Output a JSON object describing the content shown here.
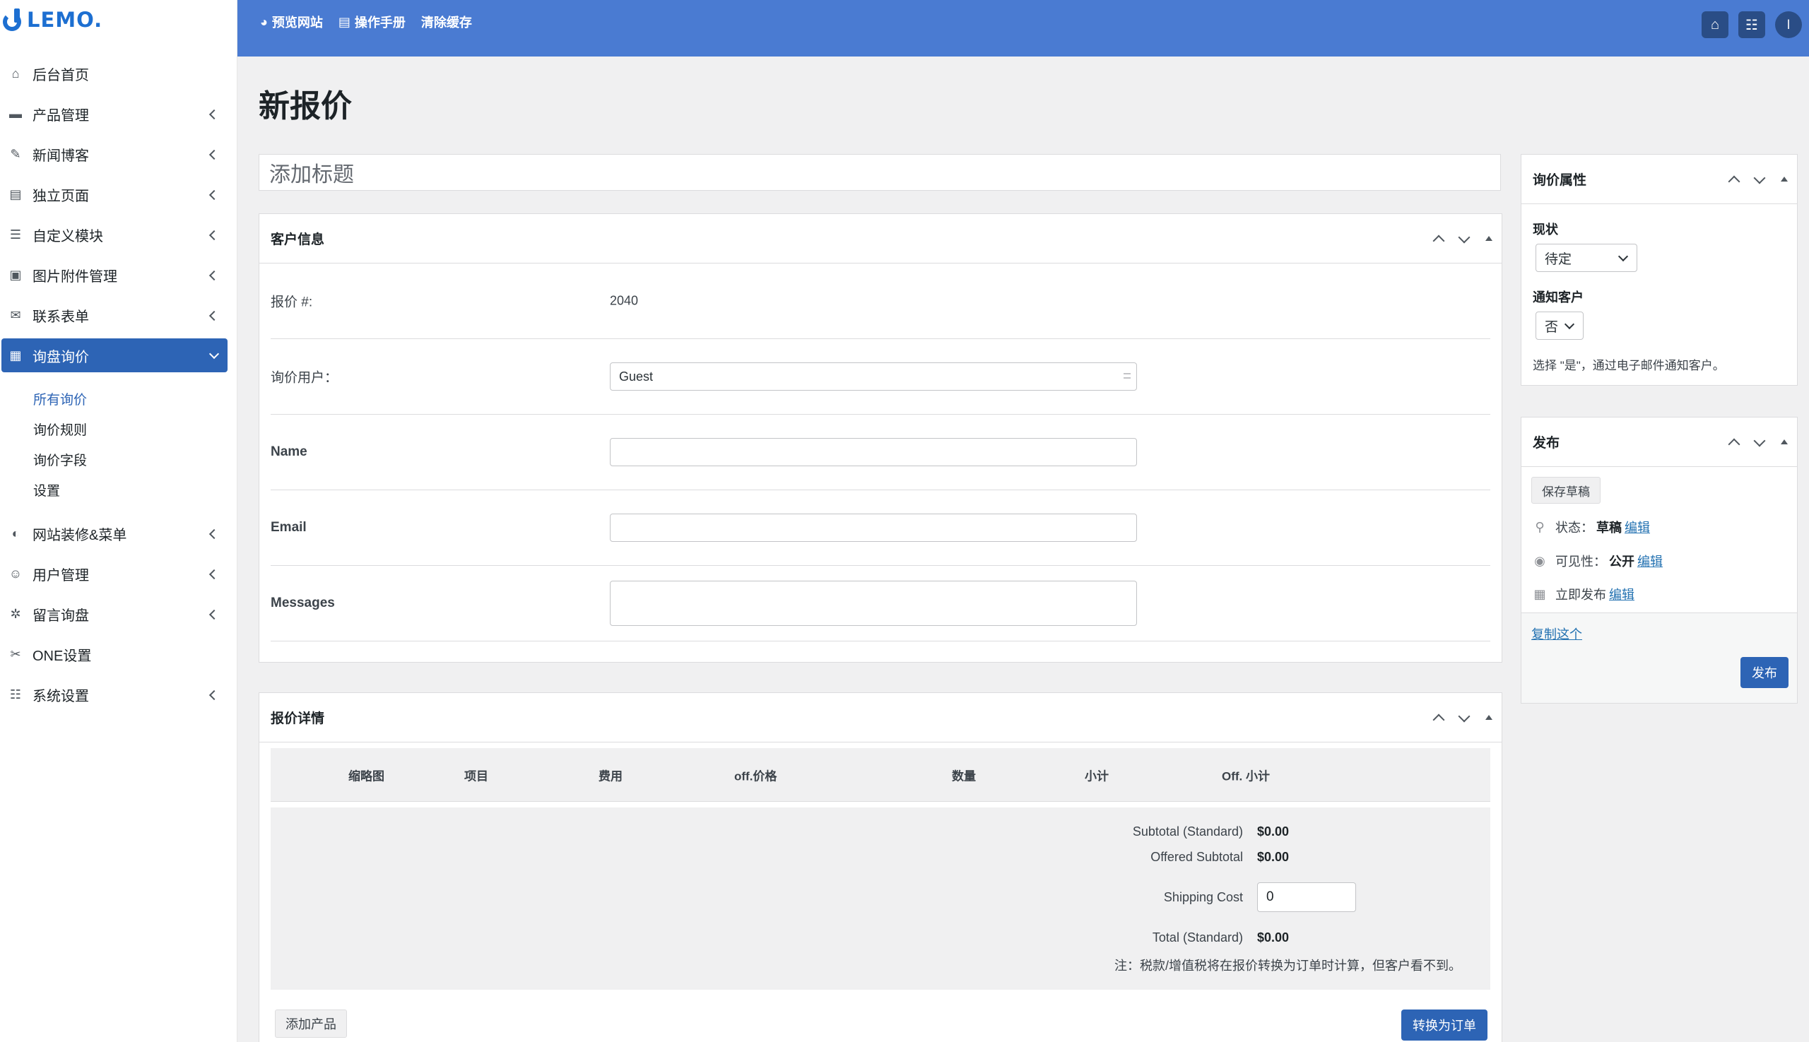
{
  "brand": {
    "logo_text": "LEMO."
  },
  "topbar": {
    "links": [
      {
        "label": "预览网站",
        "icon": "globe-icon"
      },
      {
        "label": "操作手册",
        "icon": "manual-icon"
      },
      {
        "label": "清除缓存"
      }
    ],
    "avatar_letter": "l"
  },
  "sidebar": {
    "items": [
      {
        "label": "后台首页",
        "icon": "⌂"
      },
      {
        "label": "产品管理",
        "icon": "▬"
      },
      {
        "label": "新闻博客",
        "icon": "✎"
      },
      {
        "label": "独立页面",
        "icon": "▤"
      },
      {
        "label": "自定义模块",
        "icon": "☰"
      },
      {
        "label": "图片附件管理",
        "icon": "▣"
      },
      {
        "label": "联系表单",
        "icon": "✉"
      },
      {
        "label": "询盘询价",
        "icon": "▦"
      }
    ],
    "submenu": [
      "所有询价",
      "询价规则",
      "询价字段",
      "设置"
    ],
    "items_after": [
      {
        "label": "网站装修&菜单",
        "icon": "◐"
      },
      {
        "label": "用户管理",
        "icon": "☺"
      },
      {
        "label": "留言询盘",
        "icon": "✲"
      },
      {
        "label": "ONE设置",
        "icon": "✂"
      },
      {
        "label": "系统设置",
        "icon": "☷"
      }
    ]
  },
  "main": {
    "page_title": "新报价",
    "title_placeholder": "添加标题",
    "customer": {
      "heading": "客户信息",
      "quote_no_label": "报价 #:",
      "quote_no_value": "2040",
      "user_label": "询价用户：",
      "user_value": "Guest",
      "name_label": "Name",
      "email_label": "Email",
      "messages_label": "Messages"
    },
    "details": {
      "heading": "报价详情",
      "columns": [
        "缩略图",
        "项目",
        "费用",
        "off.价格",
        "数量",
        "小计",
        "Off. 小计"
      ],
      "subtotal_label": "Subtotal (Standard)",
      "subtotal_value": "$0.00",
      "offered_label": "Offered Subtotal",
      "offered_value": "$0.00",
      "shipping_label": "Shipping Cost",
      "shipping_value": "0",
      "total_label": "Total (Standard)",
      "total_value": "$0.00",
      "note": "注：税款/增值税将在报价转换为订单时计算，但客户看不到。",
      "add_product": "添加产品",
      "convert": "转换为订单"
    }
  },
  "side": {
    "attrs": {
      "heading": "询价属性",
      "status_label": "现状",
      "status_value": "待定",
      "notify_label": "通知客户",
      "notify_value": "否",
      "notify_note": "选择 \"是\"，通过电子邮件通知客户。"
    },
    "publish": {
      "heading": "发布",
      "save_draft": "保存草稿",
      "status_prefix": "状态：",
      "status_value": "草稿",
      "visibility_prefix": "可见性：",
      "visibility_value": "公开",
      "publish_now": "立即发布",
      "edit": "编辑",
      "copy": "复制这个",
      "publish_btn": "发布"
    }
  },
  "colors": {
    "accent": "#2d64b5",
    "topbar": "#4a7bd2",
    "link": "#2271b1"
  }
}
